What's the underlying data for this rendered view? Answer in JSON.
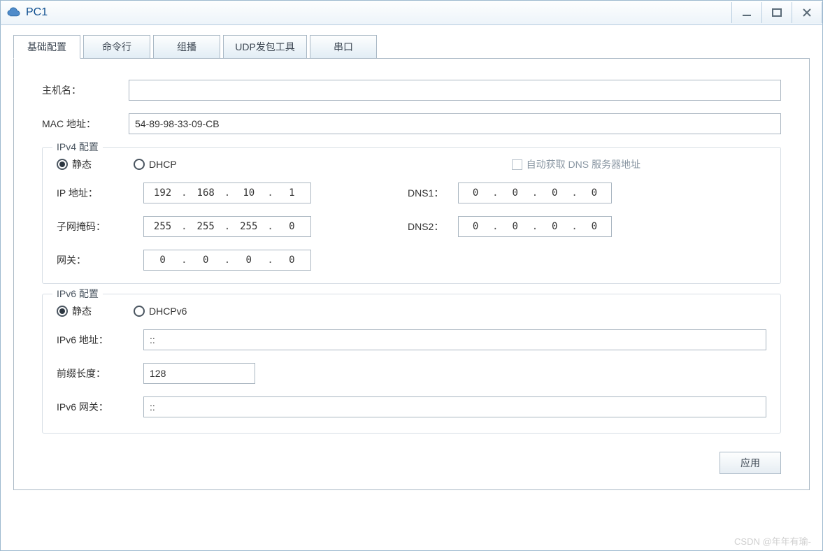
{
  "window": {
    "title": "PC1"
  },
  "tabs": {
    "basic": "基础配置",
    "cmd": "命令行",
    "mcast": "组播",
    "udp": "UDP发包工具",
    "serial": "串口"
  },
  "basic": {
    "host_label": "主机名：",
    "host_value": "",
    "mac_label": "MAC 地址：",
    "mac_value": "54-89-98-33-09-CB"
  },
  "ipv4": {
    "legend": "IPv4 配置",
    "mode_static": "静态",
    "mode_dhcp": "DHCP",
    "auto_dns": "自动获取 DNS 服务器地址",
    "ip_label": "IP 地址：",
    "ip_octets": [
      "192",
      "168",
      "10",
      "1"
    ],
    "mask_label": "子网掩码：",
    "mask_octets": [
      "255",
      "255",
      "255",
      "0"
    ],
    "gw_label": "网关：",
    "gw_octets": [
      "0",
      "0",
      "0",
      "0"
    ],
    "dns1_label": "DNS1：",
    "dns1_octets": [
      "0",
      "0",
      "0",
      "0"
    ],
    "dns2_label": "DNS2：",
    "dns2_octets": [
      "0",
      "0",
      "0",
      "0"
    ]
  },
  "ipv6": {
    "legend": "IPv6 配置",
    "mode_static": "静态",
    "mode_dhcp": "DHCPv6",
    "addr_label": "IPv6 地址：",
    "addr_value": "::",
    "prefix_label": "前缀长度：",
    "prefix_value": "128",
    "gw_label": "IPv6 网关：",
    "gw_value": "::"
  },
  "apply_label": "应用",
  "watermark": "CSDN @年年有瑜-"
}
